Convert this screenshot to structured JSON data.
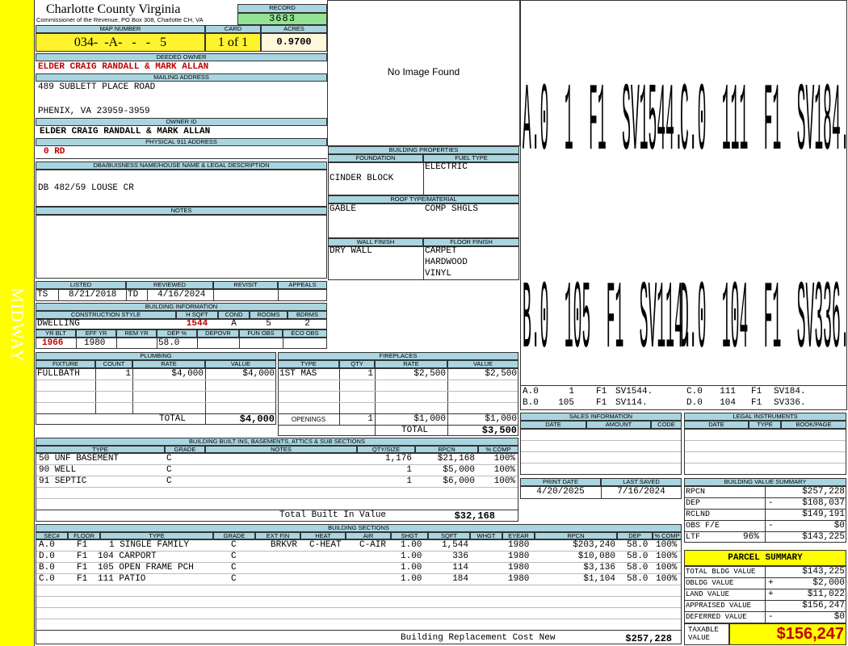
{
  "side_label": "MIDWAY",
  "header": {
    "title": "Charlotte County Virginia",
    "subtitle": "Commissioner of the Revenue, PO Box 308, Charlotte CH, VA",
    "record_label": "RECORD",
    "record": "3683"
  },
  "map": {
    "map_label": "MAP NUMBER",
    "map_number": "034-  -A-   -   -   5",
    "card_label": "CARD",
    "card": "1 of 1",
    "acres_label": "ACRES",
    "acres": "0.9700"
  },
  "owner": {
    "deeded_label": "DEEDED OWNER",
    "deeded_owner": "ELDER CRAIG RANDALL & MARK ALLAN",
    "mailing_label": "MAILING ADDRESS",
    "addr1": "489 SUBLETT PLACE ROAD",
    "addr2": "PHENIX, VA 23959-3959",
    "owner_id_label": "OWNER ID",
    "owner_id": "ELDER CRAIG RANDALL & MARK ALLAN",
    "phys_label": "PHYSICAL 911 ADDRESS",
    "phys": "0 RD"
  },
  "dba": {
    "label": "DBA/BUISNESS NAME/HOUSE NAME & LEGAL DESCRIPTION",
    "text": "DB 482/59 LOUSE CR"
  },
  "notes": {
    "label": "NOTES"
  },
  "image": {
    "text": "No Image Found"
  },
  "sketch": {
    "big": [
      "A.0 1 F1 SV1544.",
      "C.0 111 F1 SV184.",
      "B.0 105 F1 SV114.",
      "D.0 104 F1 SV336."
    ],
    "rows": [
      [
        "A.0",
        "1",
        "F1",
        "SV1544.",
        "C.0",
        "111",
        "F1",
        "SV184."
      ],
      [
        "B.0",
        "105",
        "F1",
        "SV114.",
        "D.0",
        "104",
        "F1",
        "SV336."
      ]
    ]
  },
  "props": {
    "title": "BUILDING PROPERTIES",
    "foundation_label": "FOUNDATION",
    "foundation": "CINDER BLOCK",
    "fuel_label": "FUEL TYPE",
    "fuel": "ELECTRIC",
    "roof_label": "ROOF TYPE/MATERIAL",
    "roof1": "GABLE",
    "roof2": "COMP SHGLS",
    "wall_label": "WALL FINISH",
    "wall": "DRY WALL",
    "floor_label": "FLOOR FINISH",
    "floor": [
      "CARPET",
      "HARDWOOD",
      "VINYL"
    ]
  },
  "listed": {
    "listed_label": "LISTED",
    "reviewed_label": "REVIEWED",
    "revisit_label": "REVISIT",
    "appeals_label": "APPEALS",
    "lby": "TS",
    "ldate": "8/21/2018",
    "rby": "TD",
    "rdate": "4/16/2024"
  },
  "bi": {
    "title": "BUILDING INFORMATION",
    "h_style": "CONSTRUCTION STYLE",
    "h_sqft": "H SQFT",
    "h_cond": "COND",
    "h_rooms": "ROOMS",
    "h_bdrms": "BDRMS",
    "style": "DWELLING",
    "sqft": "1544",
    "cond": "A",
    "rooms": "5",
    "bdrms": "2",
    "h_yrblt": "YR BLT",
    "h_effyr": "EFF YR",
    "h_remyr": "REM YR",
    "h_dep": "DEP %",
    "h_depovr": "DEPOVR",
    "h_funobs": "FUN OBS",
    "h_ecoobs": "ECO OBS",
    "yrblt": "1966",
    "effyr": "1980",
    "dep": "58.0"
  },
  "plumbing": {
    "title": "PLUMBING",
    "headers": [
      "FIXTURE",
      "COUNT",
      "RATE",
      "VALUE"
    ],
    "rows": [
      [
        "FULLBATH",
        "1",
        "$4,000",
        "$4,000"
      ]
    ],
    "total_label": "TOTAL",
    "total": "$4,000"
  },
  "fireplaces": {
    "title": "FIREPLACES",
    "headers": [
      "TYPE",
      "QTY",
      "RATE",
      "VALUE"
    ],
    "rows": [
      [
        "1ST MAS",
        "1",
        "$2,500",
        "$2,500"
      ]
    ],
    "openings_label": "OPENINGS",
    "openings": [
      "1",
      "$1,000",
      "$1,000"
    ],
    "total_label": "TOTAL",
    "total": "$3,500"
  },
  "builtins": {
    "title": "BUILDING BUILT INS, BASEMENTS, ATTICS & SUB SECTIONS",
    "headers": [
      "TYPE",
      "GRADE",
      "NOTES",
      "QTY/SIZE",
      "RPCN",
      "% COMP"
    ],
    "rows": [
      [
        "50 UNF BASEMENT",
        "C",
        "",
        "1,176",
        "$21,168",
        "100%"
      ],
      [
        "90 WELL",
        "C",
        "",
        "1",
        "$5,000",
        "100%"
      ],
      [
        "91 SEPTIC",
        "C",
        "",
        "1",
        "$6,000",
        "100%"
      ]
    ],
    "total_label": "Total Built In Value",
    "total": "$32,168"
  },
  "sections": {
    "title": "BUILDING SECTIONS",
    "headers": [
      "SEC#",
      "FLOOR",
      "TYPE",
      "GRADE",
      "EXT FIN",
      "HEAT",
      "AIR",
      "SHGT",
      "SQFT",
      "WHGT",
      "EYEAR",
      "RPCN",
      "DEP",
      "% COMP"
    ],
    "rows": [
      [
        "A.0",
        "F1",
        "1 SINGLE FAMILY",
        "C",
        "BRKVR",
        "C-HEAT",
        "C-AIR",
        "1.00",
        "1,544",
        "",
        "1980",
        "$203,240",
        "58.0",
        "100%"
      ],
      [
        "D.0",
        "F1",
        "104 CARPORT",
        "C",
        "",
        "",
        "",
        "1.00",
        "336",
        "",
        "1980",
        "$10,080",
        "58.0",
        "100%"
      ],
      [
        "B.0",
        "F1",
        "105 OPEN FRAME PCH",
        "C",
        "",
        "",
        "",
        "1.00",
        "114",
        "",
        "1980",
        "$3,136",
        "58.0",
        "100%"
      ],
      [
        "C.0",
        "F1",
        "111 PATIO",
        "C",
        "",
        "",
        "",
        "1.00",
        "184",
        "",
        "1980",
        "$1,104",
        "58.0",
        "100%"
      ]
    ],
    "rcn_label": "Building Replacement Cost New",
    "rcn": "$257,228"
  },
  "sales": {
    "title": "SALES INFORMATION",
    "headers": [
      "DATE",
      "AMOUNT",
      "CODE"
    ]
  },
  "legal": {
    "title": "LEGAL INSTRUMENTS",
    "headers": [
      "DATE",
      "TYPE",
      "BOOK/PAGE"
    ]
  },
  "dates": {
    "print_label": "PRINT DATE",
    "saved_label": "LAST SAVED",
    "print": "4/20/2025",
    "saved": "7/16/2024"
  },
  "bvs": {
    "title": "BUILDING VALUE SUMMARY",
    "rows": [
      {
        "label": "RPCN",
        "mid": "",
        "sign": "",
        "value": "$257,228"
      },
      {
        "label": "DEP",
        "mid": "",
        "sign": "-",
        "value": "$108,037"
      },
      {
        "label": "RCLND",
        "mid": "",
        "sign": "",
        "value": "$149,191"
      },
      {
        "label": "OBS F/E",
        "mid": "",
        "sign": "-",
        "value": "$0"
      },
      {
        "label": "LTF",
        "mid": "96%",
        "sign": "",
        "value": "$143,225"
      }
    ]
  },
  "ps": {
    "title": "PARCEL SUMMARY",
    "rows": [
      {
        "label": "TOTAL BLDG VALUE",
        "sign": "",
        "value": "$143,225"
      },
      {
        "label": "OBLDG VALUE",
        "sign": "+",
        "value": "$2,000"
      },
      {
        "label": "LAND VALUE",
        "sign": "+",
        "value": "$11,022"
      },
      {
        "label": "APPRAISED VALUE",
        "sign": "",
        "value": "$156,247"
      },
      {
        "label": "DEFERRED VALUE",
        "sign": "-",
        "value": "$0"
      }
    ],
    "taxable_label": "TAXABLE VALUE",
    "taxable": "$156,247"
  },
  "colors": {
    "side": "#ffff00",
    "header": "#a9d5e1",
    "record": "#92e492",
    "map": "#fff22e",
    "acres": "#fff8dc",
    "red": "#c00000"
  }
}
